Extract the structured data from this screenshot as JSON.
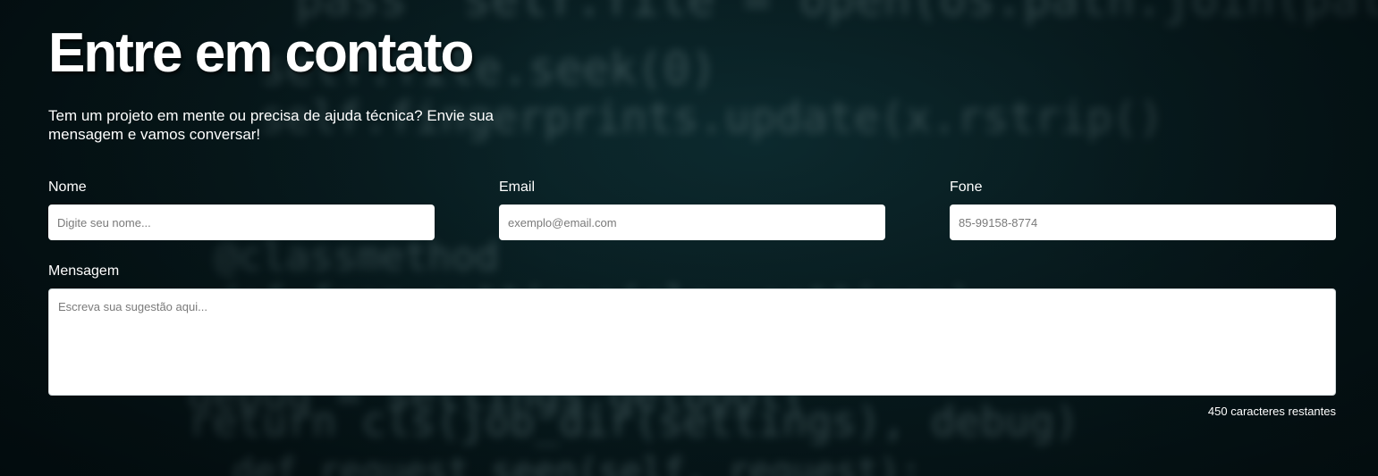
{
  "contact": {
    "title": "Entre em contato",
    "subtitle": "Tem um projeto em mente ou precisa de ajuda técnica? Envie sua mensagem e vamos conversar!"
  },
  "form": {
    "name": {
      "label": "Nome",
      "placeholder": "Digite seu nome...",
      "value": ""
    },
    "email": {
      "label": "Email",
      "placeholder": "exemplo@email.com",
      "value": ""
    },
    "phone": {
      "label": "Fone",
      "placeholder": "85-99158-8774",
      "value": ""
    },
    "message": {
      "label": "Mensagem",
      "placeholder": "Escreva sua sugestão aqui...",
      "value": ""
    },
    "char_counter": "450 caracteres restantes"
  },
  "colors": {
    "background": "#041417",
    "text": "#ffffff",
    "input_background": "#ffffff",
    "placeholder": "#7a7a7a"
  }
}
